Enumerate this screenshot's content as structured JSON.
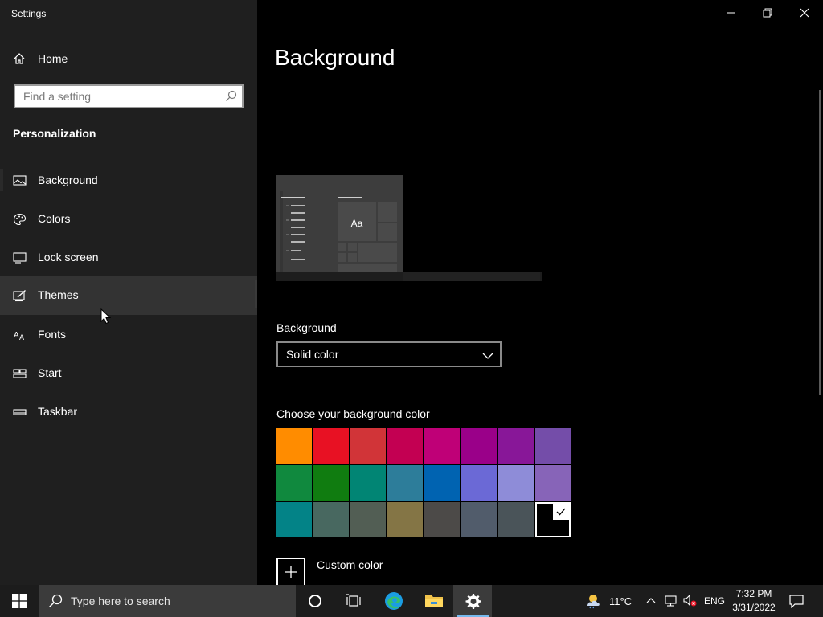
{
  "window": {
    "title": "Settings"
  },
  "sidebar": {
    "home_label": "Home",
    "search_placeholder": "Find a setting",
    "section_title": "Personalization",
    "items": [
      {
        "label": "Background",
        "icon": "picture-icon"
      },
      {
        "label": "Colors",
        "icon": "palette-icon"
      },
      {
        "label": "Lock screen",
        "icon": "lock-screen-icon"
      },
      {
        "label": "Themes",
        "icon": "themes-icon"
      },
      {
        "label": "Fonts",
        "icon": "fonts-icon"
      },
      {
        "label": "Start",
        "icon": "start-icon"
      },
      {
        "label": "Taskbar",
        "icon": "taskbar-icon"
      }
    ]
  },
  "main": {
    "title": "Background",
    "preview_sample_text": "Aa",
    "background_label": "Background",
    "background_value": "Solid color",
    "choose_color_label": "Choose your background color",
    "colors": [
      "#ff8c00",
      "#e81123",
      "#d13438",
      "#c30052",
      "#bf0077",
      "#9a0089",
      "#881798",
      "#744da9",
      "#10893e",
      "#107c10",
      "#018574",
      "#2d7d9a",
      "#0063b1",
      "#6b69d6",
      "#8e8cd8",
      "#8764b8",
      "#038387",
      "#486860",
      "#525e54",
      "#847545",
      "#4c4a48",
      "#515c6b",
      "#4a5459",
      "#000000"
    ],
    "selected_color_index": 23,
    "custom_color_label": "Custom color"
  },
  "taskbar": {
    "search_placeholder": "Type here to search",
    "weather_temp": "11°C",
    "language": "ENG",
    "time": "7:32 PM",
    "date": "3/31/2022"
  }
}
